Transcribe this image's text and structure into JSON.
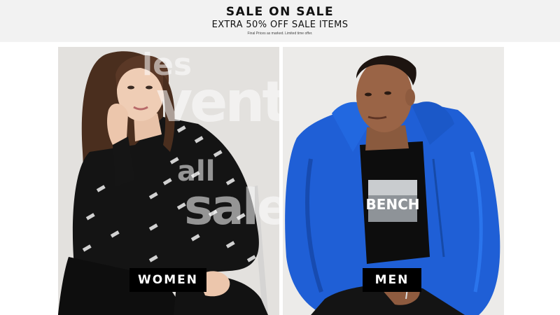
{
  "banner": {
    "title": "SALE ON SALE",
    "subtitle": "EXTRA 50% OFF SALE ITEMS",
    "fineprint": "Final Prices as marked. Limited time offer."
  },
  "categories": [
    {
      "label": "WOMEN",
      "image": "woman in black sweatshirt with white print"
    },
    {
      "label": "MEN",
      "image": "man in blue windbreaker jacket"
    }
  ],
  "watermark": {
    "lines": [
      "les",
      "ventes",
      "all",
      "sales"
    ]
  },
  "shirt_text": "BENCH",
  "colors": {
    "banner_bg": "#f2f2f2",
    "label_bg": "#000000",
    "jacket_blue": "#1f5fd6"
  }
}
